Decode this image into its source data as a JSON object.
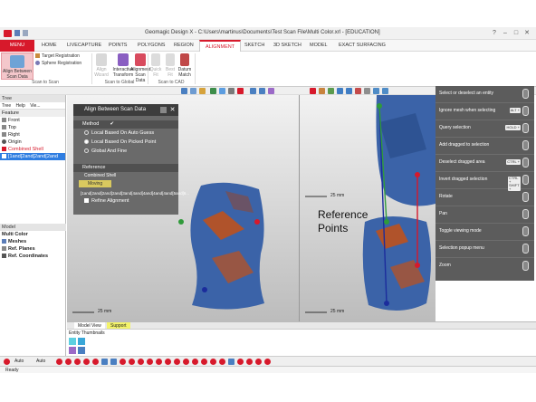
{
  "window": {
    "title": "Geomagic Design X - C:\\Users\\martinus\\Documents\\Test Scan File\\Multi Color.xrl - [EDUCATION]",
    "controls": [
      "?",
      "–",
      "□",
      "✕"
    ]
  },
  "tabs": [
    {
      "label": "MENU",
      "state": "menu"
    },
    {
      "label": "HOME",
      "state": ""
    },
    {
      "label": "LIVECAPTURE",
      "state": ""
    },
    {
      "label": "POINTS",
      "state": ""
    },
    {
      "label": "POLYGONS",
      "state": ""
    },
    {
      "label": "REGION",
      "state": ""
    },
    {
      "label": "ALIGNMENT",
      "state": "active"
    },
    {
      "label": "SKETCH",
      "state": ""
    },
    {
      "label": "3D SKETCH",
      "state": ""
    },
    {
      "label": "MODEL",
      "state": ""
    },
    {
      "label": "EXACT SURFACING",
      "state": ""
    }
  ],
  "ribbon": {
    "align_between": "Align Between Scan Data",
    "target_registration": "Target Registration",
    "sphere_registration": "Sphere Registration",
    "align_wizard": "Align Wizard",
    "interactive_transform": "Interactive Transform",
    "alignment_scan_data": "Alignment Scan Data",
    "quick_fit": "Quick Fit",
    "best_fit": "Best Fit",
    "datum_match": "Datum Match",
    "group_scan_to_scan": "Scan to Scan",
    "group_scan_to_global": "Scan to Global",
    "group_scan_to_cad": "Scan to CAD"
  },
  "left_panel": {
    "tree_title": "Tree",
    "tree_tabs": [
      "Tree",
      "Help",
      "Vie..."
    ],
    "feature_header": "Feature",
    "feature_items": [
      "Front",
      "Top",
      "Right",
      "Origin",
      "Combined Shell",
      "[1and[2and[2and[2and"
    ],
    "model_title": "Model",
    "model_items": [
      "Multi Color",
      "Meshes",
      "Ref. Planes",
      "Ref. Coordinates"
    ]
  },
  "dialog": {
    "title": "Align Between Scan Data",
    "method_label": "Method",
    "options": [
      "Local Based On Auto Guess",
      "Local Based On Picked Point",
      "Global And Fine"
    ],
    "reference_label": "Reference",
    "reference_value": "Combined Shell",
    "moving_label": "Moving",
    "moving_value": "[1and[2and[2and[2and[3and[4and[4and[4and[4and[5and[6...",
    "refine_label": "Refine Alignment"
  },
  "viewport": {
    "scale_label": "25 mm",
    "annotation": "Reference Points"
  },
  "help_panel": [
    {
      "text": "Select or deselect an entity",
      "key": ""
    },
    {
      "text": "Ignore mesh when selecting",
      "key": "ALT +"
    },
    {
      "text": "Query selection",
      "key": "HOLD +"
    },
    {
      "text": "Add dragged to selection",
      "key": ""
    },
    {
      "text": "Deselect dragged area",
      "key": "CTRL +"
    },
    {
      "text": "Invert dragged selection",
      "key": "CTRL + SHIFT +"
    },
    {
      "text": "Rotate",
      "key": ""
    },
    {
      "text": "Pan",
      "key": ""
    },
    {
      "text": "Toggle viewing mode",
      "key": ""
    },
    {
      "text": "Selection popup menu",
      "key": ""
    },
    {
      "text": "Zoom",
      "key": ""
    }
  ],
  "bottom": {
    "model_view_tab": "Model View",
    "support_tab": "Support",
    "thumbs_title": "Entity Thumbnails",
    "auto1": "Auto",
    "auto2": "Auto",
    "status": "Ready"
  },
  "colors": {
    "brand_red": "#d7192b",
    "scan_blue": "#3b63a8",
    "scan_orange": "#b0532b",
    "dialog_bg": "#6a6a6a",
    "help_bg": "#5c5c5c"
  }
}
